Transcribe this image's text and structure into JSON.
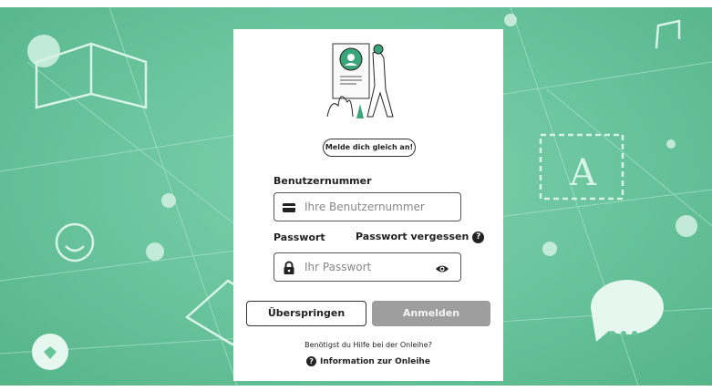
{
  "login": {
    "hint_pill": "Melde dich gleich an!",
    "username_label": "Benutzernummer",
    "username_placeholder": "Ihre Benutzernummer",
    "password_label": "Passwort",
    "forgot_password": "Passwort vergessen",
    "password_placeholder": "Ihr Passwort",
    "skip_button": "Überspringen",
    "login_button": "Anmelden",
    "help_question": "Benötigst du Hilfe bei der Onleihe?",
    "info_link": "Information zur Onleihe"
  },
  "icons": {
    "card": "id-card-icon",
    "lock": "lock-icon",
    "eye": "eye-icon",
    "help": "question-circle-icon"
  },
  "colors": {
    "background": "#68c39b",
    "login_button_bg": "#9e9e9e",
    "text": "#222222"
  }
}
